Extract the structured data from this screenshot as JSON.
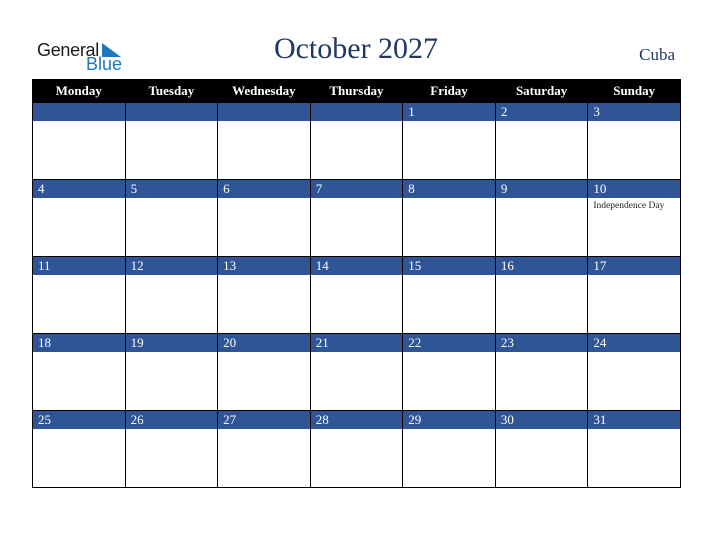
{
  "logo": {
    "line1": "General",
    "line2": "Blue"
  },
  "title": "October 2027",
  "country": "Cuba",
  "colors": {
    "header_bg": "#000000",
    "day_strip": "#2f5597",
    "title": "#1f3864",
    "logo_blue": "#1d77c1"
  },
  "weekdays": [
    "Monday",
    "Tuesday",
    "Wednesday",
    "Thursday",
    "Friday",
    "Saturday",
    "Sunday"
  ],
  "weeks": [
    [
      {
        "day": ""
      },
      {
        "day": ""
      },
      {
        "day": ""
      },
      {
        "day": ""
      },
      {
        "day": "1"
      },
      {
        "day": "2"
      },
      {
        "day": "3"
      }
    ],
    [
      {
        "day": "4"
      },
      {
        "day": "5"
      },
      {
        "day": "6"
      },
      {
        "day": "7"
      },
      {
        "day": "8"
      },
      {
        "day": "9"
      },
      {
        "day": "10",
        "event": "Independence Day"
      }
    ],
    [
      {
        "day": "11"
      },
      {
        "day": "12"
      },
      {
        "day": "13"
      },
      {
        "day": "14"
      },
      {
        "day": "15"
      },
      {
        "day": "16"
      },
      {
        "day": "17"
      }
    ],
    [
      {
        "day": "18"
      },
      {
        "day": "19"
      },
      {
        "day": "20"
      },
      {
        "day": "21"
      },
      {
        "day": "22"
      },
      {
        "day": "23"
      },
      {
        "day": "24"
      }
    ],
    [
      {
        "day": "25"
      },
      {
        "day": "26"
      },
      {
        "day": "27"
      },
      {
        "day": "28"
      },
      {
        "day": "29"
      },
      {
        "day": "30"
      },
      {
        "day": "31"
      }
    ]
  ]
}
